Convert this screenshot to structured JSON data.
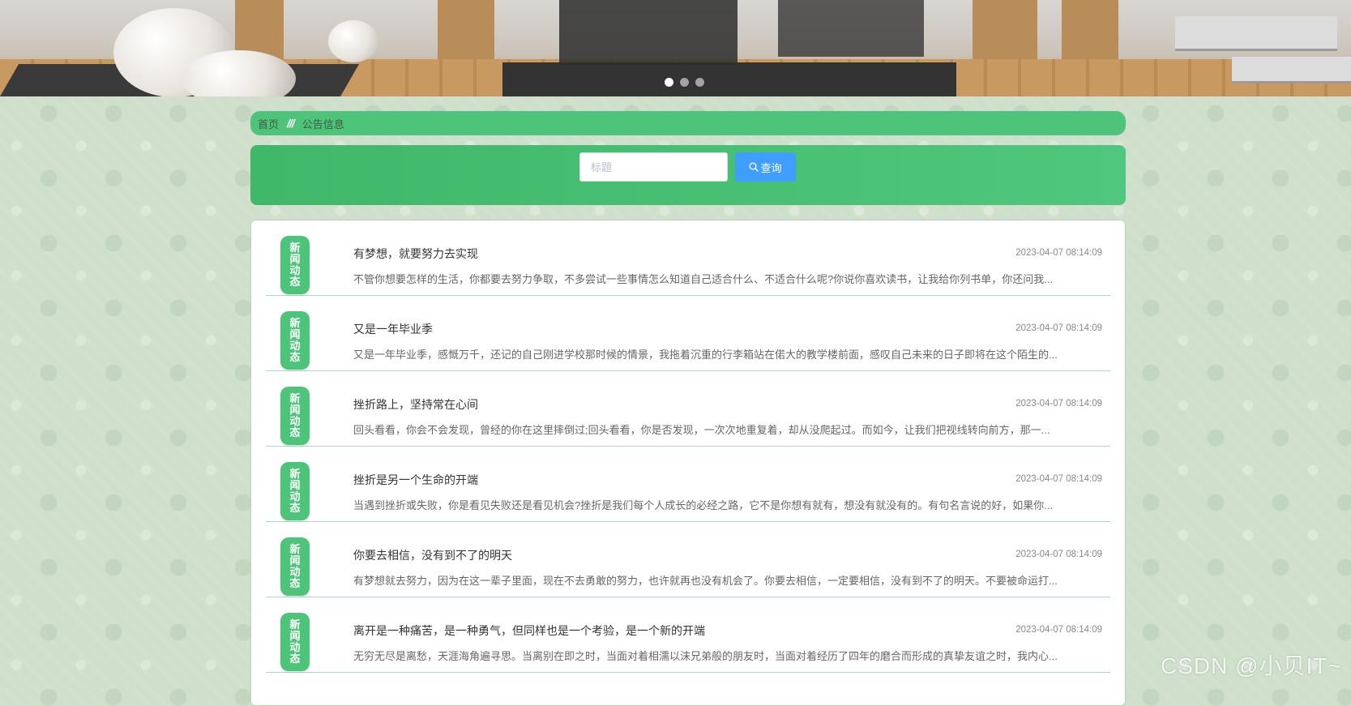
{
  "banner": {
    "active_slide": 1,
    "slide_count": 3
  },
  "breadcrumb": {
    "home": "首页",
    "separator": "///",
    "current": "公告信息"
  },
  "search": {
    "placeholder": "标题",
    "value": "",
    "button_label": "查询",
    "button_icon": "search-icon"
  },
  "news": {
    "badge_text": "新闻动态",
    "items": [
      {
        "title": "有梦想，就要努力去实现",
        "date": "2023-04-07 08:14:09",
        "summary": "不管你想要怎样的生活，你都要去努力争取，不多尝试一些事情怎么知道自己适合什么、不适合什么呢?你说你喜欢读书，让我给你列书单，你还问我..."
      },
      {
        "title": "又是一年毕业季",
        "date": "2023-04-07 08:14:09",
        "summary": "又是一年毕业季，感慨万千，还记的自己刚进学校那时候的情景，我拖着沉重的行李箱站在偌大的教学楼前面，感叹自己未来的日子即将在这个陌生的..."
      },
      {
        "title": "挫折路上，坚持常在心间",
        "date": "2023-04-07 08:14:09",
        "summary": "回头看看，你会不会发现，曾经的你在这里摔倒过;回头看看，你是否发现，一次次地重复着，却从没爬起过。而如今，让我们把视线转向前方，那一..."
      },
      {
        "title": "挫折是另一个生命的开端",
        "date": "2023-04-07 08:14:09",
        "summary": "当遇到挫折或失败，你是看见失败还是看见机会?挫折是我们每个人成长的必经之路，它不是你想有就有，想没有就没有的。有句名言说的好，如果你..."
      },
      {
        "title": "你要去相信，没有到不了的明天",
        "date": "2023-04-07 08:14:09",
        "summary": "有梦想就去努力，因为在这一辈子里面，现在不去勇敢的努力，也许就再也没有机会了。你要去相信，一定要相信，没有到不了的明天。不要被命运打..."
      },
      {
        "title": "离开是一种痛苦，是一种勇气，但同样也是一个考验，是一个新的开端",
        "date": "2023-04-07 08:14:09",
        "summary": "无穷无尽是离愁，天涯海角遍寻思。当离别在即之时，当面对着相濡以沫兄弟般的朋友时，当面对着经历了四年的磨合而形成的真挚友谊之时，我内心..."
      }
    ]
  },
  "watermark": "CSDN @小贝IT~",
  "colors": {
    "primary_green": "#4ec47a",
    "search_button": "#409eff",
    "page_background": "#cfdfcb"
  }
}
